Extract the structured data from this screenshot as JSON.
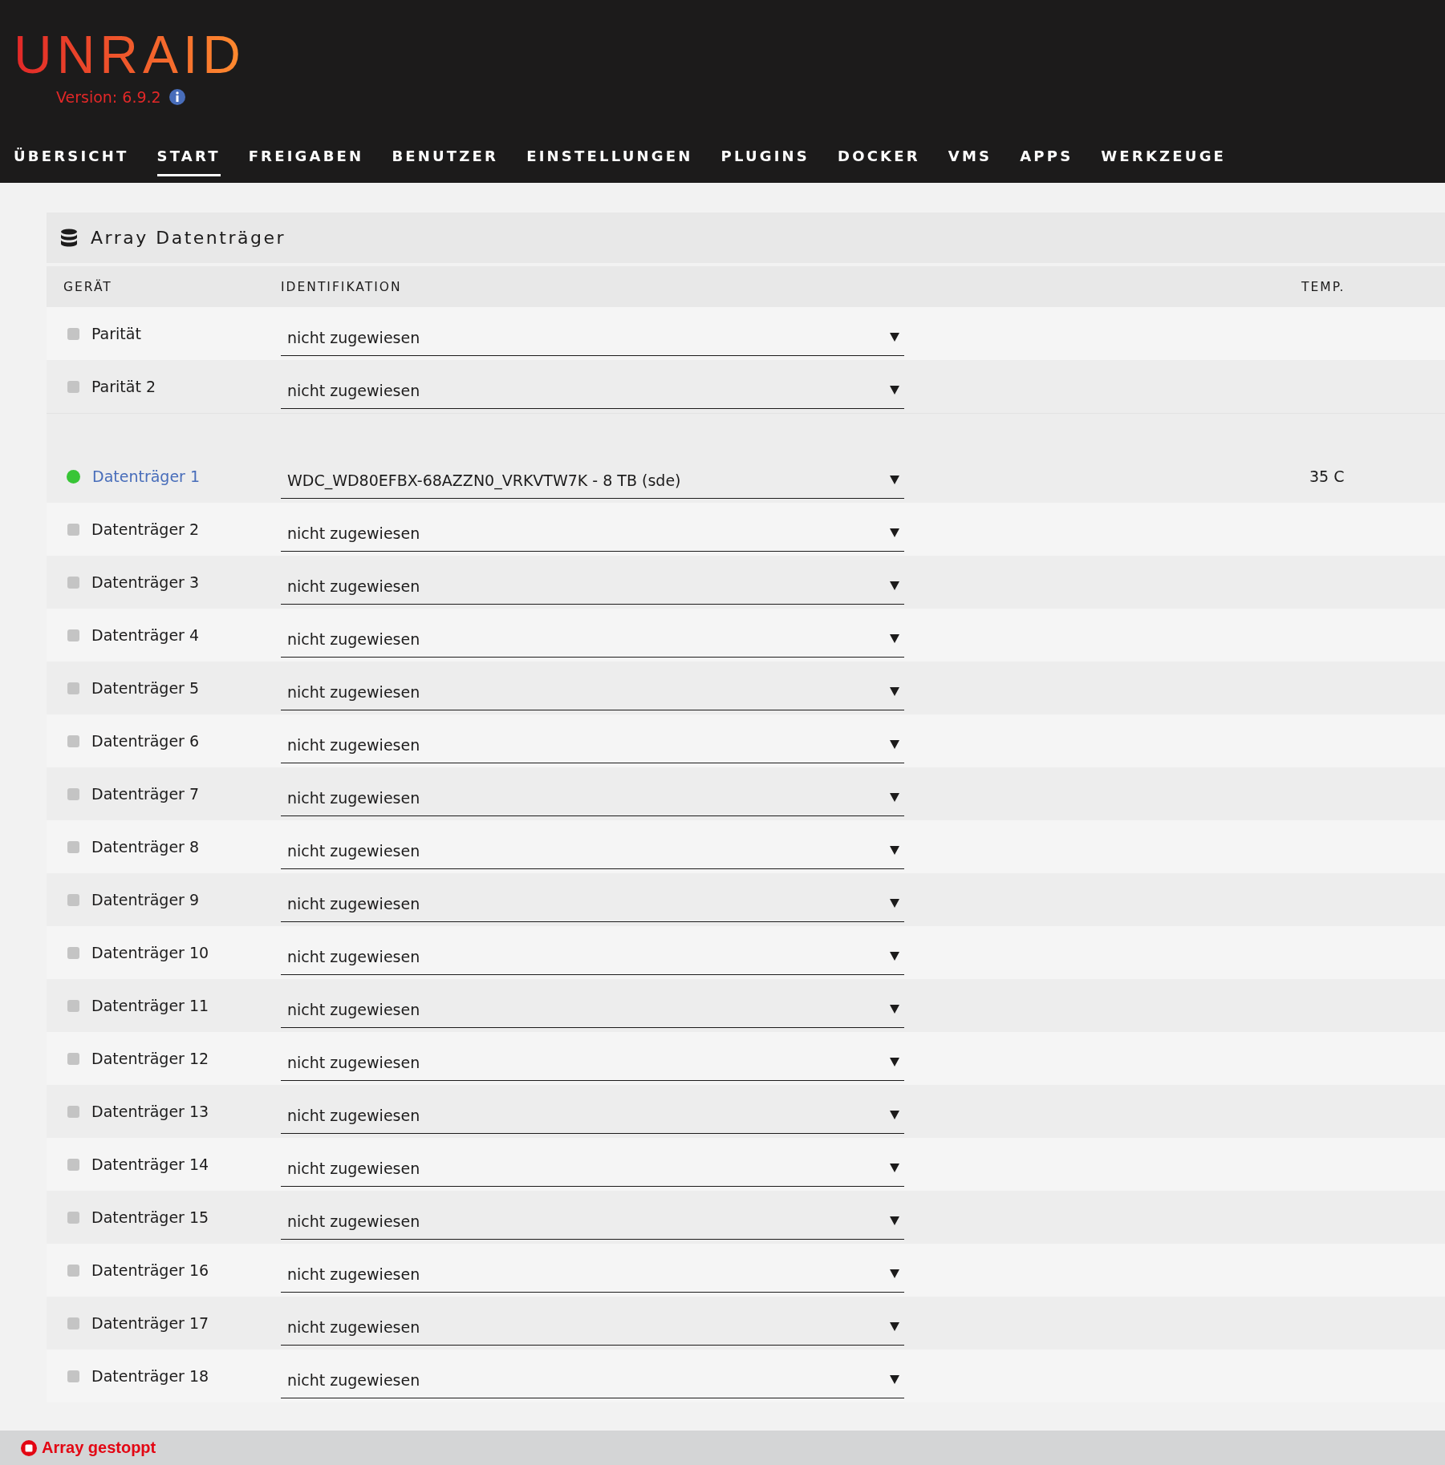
{
  "header": {
    "logo": "UNRAID",
    "version": "Version: 6.9.2"
  },
  "nav": [
    {
      "label": "ÜBERSICHT",
      "selected": false
    },
    {
      "label": "START",
      "selected": true
    },
    {
      "label": "FREIGABEN",
      "selected": false
    },
    {
      "label": "BENUTZER",
      "selected": false
    },
    {
      "label": "EINSTELLUNGEN",
      "selected": false
    },
    {
      "label": "PLUGINS",
      "selected": false
    },
    {
      "label": "DOCKER",
      "selected": false
    },
    {
      "label": "VMS",
      "selected": false
    },
    {
      "label": "APPS",
      "selected": false
    },
    {
      "label": "WERKZEUGE",
      "selected": false
    }
  ],
  "panel": {
    "title": "Array Datenträger",
    "columns": [
      "GERÄT",
      "IDENTIFIKATION",
      "TEMP."
    ],
    "parity_slots": [
      {
        "device": "Parität",
        "active": false,
        "identification": "nicht zugewiesen"
      },
      {
        "device": "Parität 2",
        "active": false,
        "identification": "nicht zugewiesen"
      }
    ],
    "data_slots": [
      {
        "device": "Datenträger 1",
        "active": true,
        "identification": "WDC_WD80EFBX-68AZZN0_VRKVTW7K - 8 TB (sde)",
        "temp": "35 C"
      },
      {
        "device": "Datenträger 2",
        "active": false,
        "identification": "nicht zugewiesen"
      },
      {
        "device": "Datenträger 3",
        "active": false,
        "identification": "nicht zugewiesen"
      },
      {
        "device": "Datenträger 4",
        "active": false,
        "identification": "nicht zugewiesen"
      },
      {
        "device": "Datenträger 5",
        "active": false,
        "identification": "nicht zugewiesen"
      },
      {
        "device": "Datenträger 6",
        "active": false,
        "identification": "nicht zugewiesen"
      },
      {
        "device": "Datenträger 7",
        "active": false,
        "identification": "nicht zugewiesen"
      },
      {
        "device": "Datenträger 8",
        "active": false,
        "identification": "nicht zugewiesen"
      },
      {
        "device": "Datenträger 9",
        "active": false,
        "identification": "nicht zugewiesen"
      },
      {
        "device": "Datenträger 10",
        "active": false,
        "identification": "nicht zugewiesen"
      },
      {
        "device": "Datenträger 11",
        "active": false,
        "identification": "nicht zugewiesen"
      },
      {
        "device": "Datenträger 12",
        "active": false,
        "identification": "nicht zugewiesen"
      },
      {
        "device": "Datenträger 13",
        "active": false,
        "identification": "nicht zugewiesen"
      },
      {
        "device": "Datenträger 14",
        "active": false,
        "identification": "nicht zugewiesen"
      },
      {
        "device": "Datenträger 15",
        "active": false,
        "identification": "nicht zugewiesen"
      },
      {
        "device": "Datenträger 16",
        "active": false,
        "identification": "nicht zugewiesen"
      },
      {
        "device": "Datenträger 17",
        "active": false,
        "identification": "nicht zugewiesen"
      },
      {
        "device": "Datenträger 18",
        "active": false,
        "identification": "nicht zugewiesen"
      }
    ]
  },
  "status_bar": {
    "text": "Array gestoppt"
  }
}
